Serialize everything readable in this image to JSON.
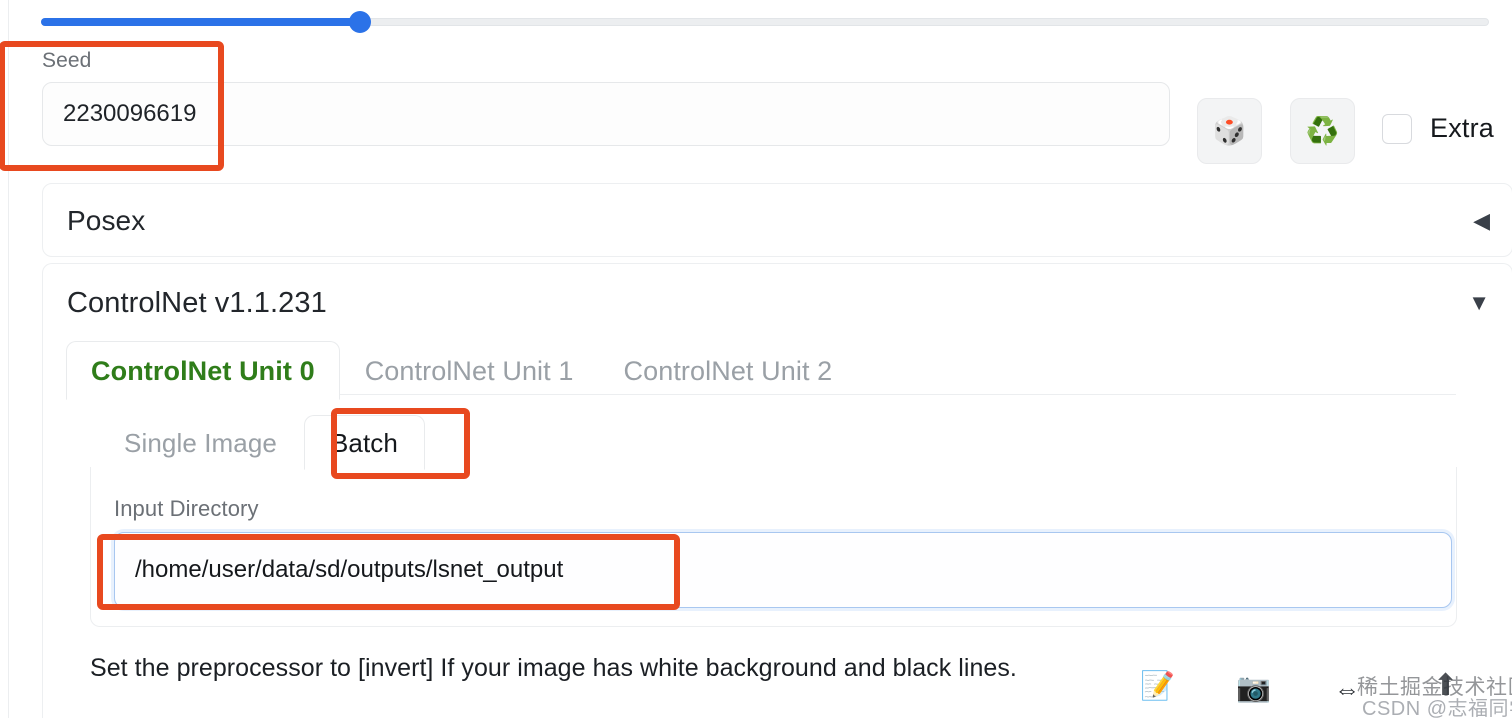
{
  "slider": {
    "name": "parameter-slider",
    "value_percent": 22,
    "fill_color": "#2b72e8",
    "track_color": "#eceef0"
  },
  "seed": {
    "label": "Seed",
    "value": "2230096619",
    "placeholder": ""
  },
  "seed_actions": {
    "dice_icon": "🎲",
    "recycle_icon": "♻️",
    "extra_label": "Extra",
    "extra_checked": false
  },
  "panels": [
    {
      "title": "Posex",
      "arrow": "◀",
      "expanded": false
    },
    {
      "title": "ControlNet v1.1.231",
      "arrow": "▼",
      "expanded": true
    }
  ],
  "unit_tabs": [
    {
      "label": "ControlNet Unit 0",
      "active": true
    },
    {
      "label": "ControlNet Unit 1",
      "active": false
    },
    {
      "label": "ControlNet Unit 2",
      "active": false
    }
  ],
  "mode_tabs": [
    {
      "label": "Single Image",
      "active": false
    },
    {
      "label": "Batch",
      "active": true
    }
  ],
  "batch": {
    "input_directory_label": "Input Directory",
    "input_directory_value": "/home/user/data/sd/outputs/lsnet_output"
  },
  "hint": {
    "text": "Set the preprocessor to [invert] If your image has white background and black lines."
  },
  "bottom_icons": {
    "edit_icon": "📝",
    "camera_icon": "📷",
    "swap_icon": "⇔"
  },
  "watermarks": {
    "juejin": "稀土掘金技术社区",
    "csdn": "CSDN @志福同学",
    "arrow_up": "⬆"
  },
  "annotation": {
    "color": "#e8491f"
  }
}
